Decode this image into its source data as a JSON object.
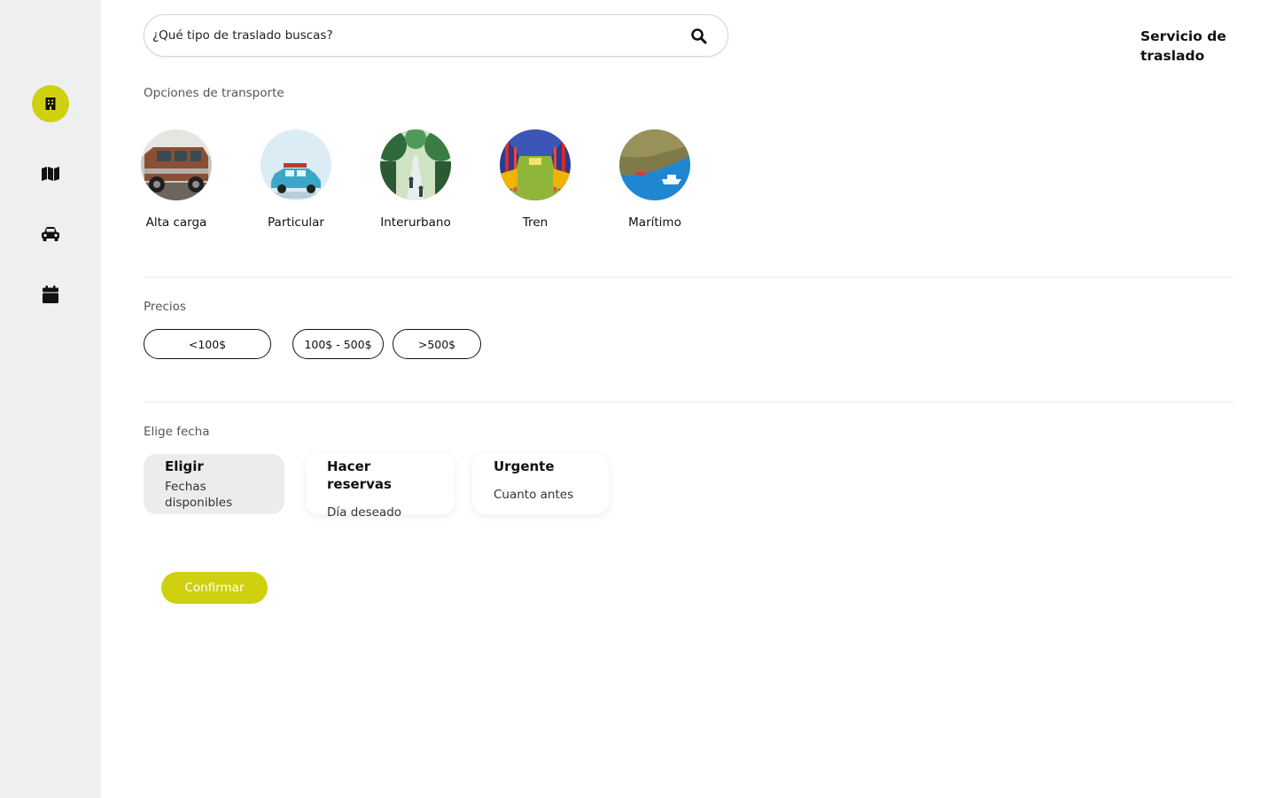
{
  "app": {
    "brand": "Servicio de traslado",
    "accent_color": "#cfd010"
  },
  "sidebar": {
    "items": [
      {
        "icon": "building-icon",
        "active": true
      },
      {
        "icon": "map-icon",
        "active": false
      },
      {
        "icon": "car-icon",
        "active": false
      },
      {
        "icon": "calendar-icon",
        "active": false
      }
    ]
  },
  "search": {
    "placeholder": "¿Qué tipo de traslado buscas?",
    "value": "",
    "icon": "search-icon"
  },
  "transport": {
    "label": "Opciones de transporte",
    "options": [
      {
        "label": "Alta carga"
      },
      {
        "label": "Particular"
      },
      {
        "label": "Interurbano"
      },
      {
        "label": "Tren"
      },
      {
        "label": "Marítimo"
      }
    ]
  },
  "prices": {
    "label": "Precios",
    "options": [
      "<100$",
      "100$ - 500$",
      ">500$"
    ]
  },
  "dates": {
    "label": "Elige fecha",
    "options": [
      {
        "title": "Eligir",
        "subtitle": "Fechas disponibles",
        "selected": true
      },
      {
        "title": "Hacer reservas",
        "subtitle": "Día deseado",
        "selected": false
      },
      {
        "title": "Urgente",
        "subtitle": "Cuanto antes",
        "selected": false
      }
    ]
  },
  "actions": {
    "confirm_label": "Confirmar"
  }
}
